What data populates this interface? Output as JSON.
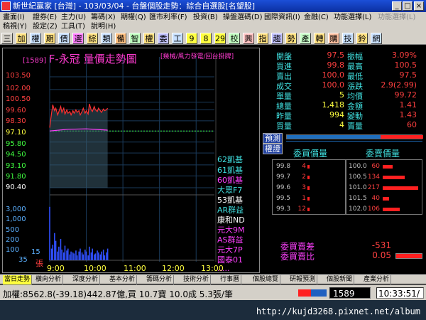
{
  "window": {
    "title": "新世紀贏家 [台灣] - 103/03/04 - 台盤個股走勢：綜合自選股[名望股]",
    "minimize": "_",
    "maximize": "□",
    "close": "×"
  },
  "menu": {
    "row1": [
      "畫面(I)",
      "證券(E)",
      "主力(U)",
      "籌碼(X)",
      "期權(Q)",
      "匯市利率(F)",
      "投資(B)",
      "操盤選碼(D)",
      "國際資訊(I)",
      "金融(C)",
      "功能選擇(L)",
      "功能選擇(L)"
    ],
    "row2": [
      "稿視(Y)",
      "設定(Z)",
      "工具(T)",
      "說明(H)"
    ]
  },
  "toolbar": {
    "buttons": [
      "三",
      "加",
      "權",
      "期",
      "價",
      "選",
      "綜",
      "類",
      "備",
      "智",
      "權",
      "委",
      "工",
      "9",
      "8",
      "29",
      "校",
      "興",
      "指",
      "趨",
      "勢",
      "產",
      "轉",
      "購",
      "技",
      "鈴",
      "網"
    ]
  },
  "chart": {
    "code": "[1589]",
    "name": "F-永冠  量價走勢圖",
    "views": "[幾械/風力發電/回台掛牌]",
    "price_labels": [
      "103.50",
      "102.00",
      "100.50",
      "99.60",
      "98.30",
      "97.10",
      "95.80",
      "94.50",
      "93.10",
      "91.80",
      "90.40"
    ],
    "volume_labels": [
      "3,000",
      "1,000",
      "500",
      "200",
      "100",
      "35",
      "15"
    ],
    "volume_unit": "張",
    "time_labels": [
      "9:00",
      "10:00",
      "11:00",
      "12:00",
      "13:00"
    ],
    "brokers": [
      "62凱基",
      "61凱基",
      "60凱基",
      "大眾F7",
      "53凱基",
      "AR群益",
      "康和ND",
      "元大9M",
      "AS群益",
      "元大7P",
      "國泰01",
      "....."
    ]
  },
  "chart_data": {
    "type": "line",
    "title": "F-永冠  量價走勢圖",
    "xlabel": "",
    "ylabel": "",
    "x_ticks": [
      "9:00",
      "10:00",
      "11:00",
      "12:00",
      "13:00"
    ],
    "ylim": [
      90.4,
      103.5
    ],
    "reference_price": 97.1,
    "series": [
      {
        "x": [
          "9:00",
          "9:03",
          "9:05",
          "9:08",
          "9:10",
          "9:13",
          "9:15",
          "9:18",
          "9:20",
          "9:23",
          "9:25",
          "9:28",
          "9:30",
          "9:33",
          "9:35",
          "9:38",
          "9:40",
          "9:43",
          "9:45",
          "9:48",
          "9:50",
          "9:53",
          "9:55",
          "9:58",
          "10:00",
          "10:03",
          "10:05",
          "10:08",
          "10:10",
          "10:13",
          "10:15",
          "10:18",
          "10:20",
          "10:23",
          "10:25",
          "10:28",
          "10:30",
          "10:33",
          "10:35"
        ],
        "y": [
          97.5,
          99.2,
          100.2,
          99.5,
          99.8,
          99.0,
          99.4,
          100.0,
          99.3,
          99.8,
          99.1,
          99.6,
          99.2,
          99.4,
          99.0,
          99.5,
          99.2,
          99.6,
          99.3,
          99.5,
          99.0,
          99.4,
          99.8,
          99.2,
          99.5,
          99.1,
          100.3,
          99.6,
          99.4,
          100.0,
          99.6,
          99.4,
          99.8,
          99.5,
          99.3,
          99.7,
          99.5,
          99.6,
          99.8
        ]
      },
      {
        "x": [
          "9:00",
          "9:30",
          "10:00",
          "10:35"
        ],
        "y": [
          97.1,
          97.3,
          97.35,
          97.2
        ]
      }
    ],
    "volume": [
      55,
      12,
      16,
      28,
      20,
      9,
      14,
      22,
      11,
      8,
      15,
      10,
      12,
      6,
      9,
      8,
      7,
      10,
      5,
      9,
      12,
      8,
      6,
      11,
      9,
      5,
      14,
      8,
      12,
      6,
      7,
      10,
      8,
      6,
      9,
      11,
      5,
      8,
      12
    ]
  },
  "quote": {
    "rows": [
      {
        "k1": "開盤",
        "v1": "97.5",
        "c1": "r",
        "k2": "振幅",
        "v2": "3.09%",
        "c2": "r"
      },
      {
        "k1": "買進",
        "v1": "99.8",
        "c1": "r",
        "k2": "最高",
        "v2": "100.5",
        "c2": "r"
      },
      {
        "k1": "賣出",
        "v1": "100.0",
        "c1": "r",
        "k2": "最低",
        "v2": "97.5",
        "c2": "r"
      },
      {
        "k1": "成交",
        "v1": "100.0",
        "c1": "r",
        "k2": "漲跌",
        "v2": "2.9(2.99)",
        "c2": "r"
      },
      {
        "k1": "單量",
        "v1": "5",
        "c1": "y",
        "k2": "均價",
        "v2": "99.72",
        "c2": "r"
      },
      {
        "k1": "總量",
        "v1": "1,418",
        "c1": "y",
        "k2": "金額",
        "v2": "1.41",
        "c2": "r"
      },
      {
        "k1": "昨量",
        "v1": "994",
        "c1": "y",
        "k2": "變動",
        "v2": "1.43",
        "c2": "r"
      },
      {
        "k1": "買量",
        "v1": "4",
        "c1": "y",
        "k2": "賣量",
        "v2": "60",
        "c2": "r"
      }
    ],
    "tag_forecast": "預測",
    "tag_warrant": "權證",
    "order_head_bid": "委買價量",
    "order_head_ask": "委賣價量",
    "bids": [
      {
        "price": "99.8",
        "qty": "4"
      },
      {
        "price": "99.7",
        "qty": "2"
      },
      {
        "price": "99.6",
        "qty": "3"
      },
      {
        "price": "99.5",
        "qty": "1"
      },
      {
        "price": "99.3",
        "qty": "12"
      }
    ],
    "asks": [
      {
        "price": "100.0",
        "qty": "60"
      },
      {
        "price": "100.5",
        "qty": "134"
      },
      {
        "price": "101.0",
        "qty": "217"
      },
      {
        "price": "101.5",
        "qty": "40"
      },
      {
        "price": "102.0",
        "qty": "106"
      }
    ],
    "diff_label": "委買賣差",
    "diff_value": "-531",
    "ratio_label": "委買賣比",
    "ratio_value": "0.05"
  },
  "tabs": [
    "當日走勢",
    "橫向分析",
    "深度分析",
    "基本分析",
    "籌碼分析",
    "技術分析",
    "行事曆",
    "個股總覽",
    "研報預測",
    "個股新聞",
    "產業分析"
  ],
  "status": {
    "index": "加權:8562.8(-39.18)442.87億,買 10.7寶 10.0成 5.3張/筆",
    "code": "1589",
    "time": "10:33:51/"
  },
  "overlay": {
    "url": "http://kujd3268.pixnet.net/album"
  }
}
